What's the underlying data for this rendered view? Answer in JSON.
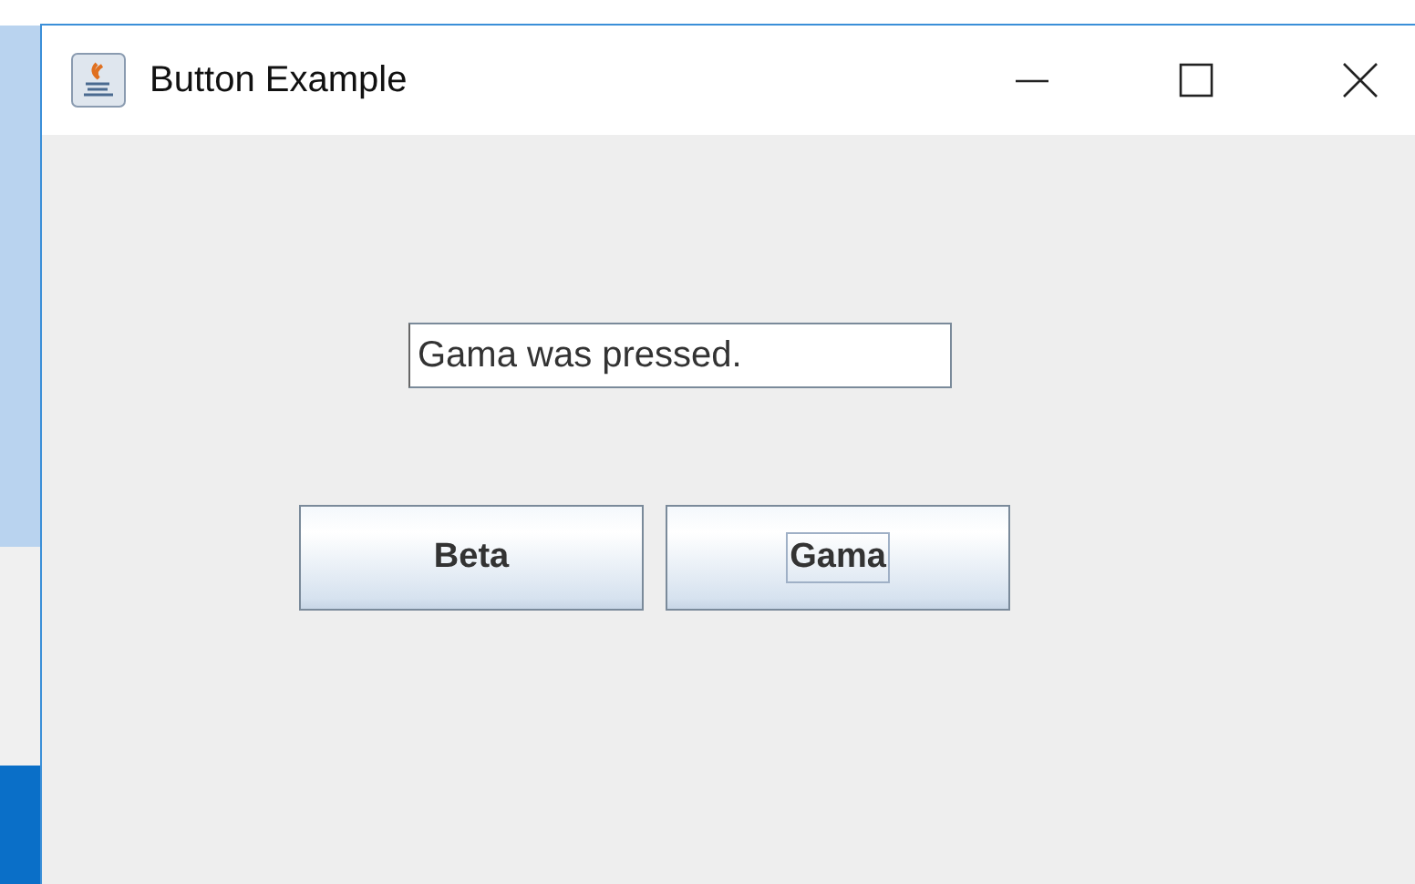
{
  "window": {
    "title": "Button Example"
  },
  "text_field": {
    "value": "Gama was pressed."
  },
  "buttons": [
    {
      "label": "Beta",
      "focused": false
    },
    {
      "label": "Gama",
      "focused": true
    }
  ]
}
